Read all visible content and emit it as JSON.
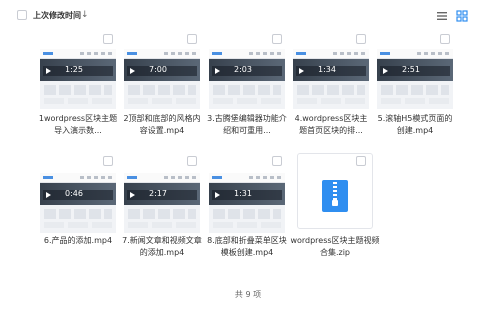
{
  "toolbar": {
    "sort_label": "上次修改时间",
    "sort_arrow": "↓",
    "list_view_icon": "list-view-icon",
    "grid_view_icon": "grid-view-icon",
    "active_view": "grid",
    "accent_color": "#2f8ef0"
  },
  "files": [
    {
      "name": "1wordpress区块主题导入演示数...",
      "type": "video",
      "duration": "1:25"
    },
    {
      "name": "2顶部和底部的风格内容设置.mp4",
      "type": "video",
      "duration": "7:00"
    },
    {
      "name": "3.古腾堡编辑器功能介绍和可重用...",
      "type": "video",
      "duration": "2:03"
    },
    {
      "name": "4.wordpress区块主题首页区块的排...",
      "type": "video",
      "duration": "1:34"
    },
    {
      "name": "5.滚轴H5模式页面的创建.mp4",
      "type": "video",
      "duration": "2:51"
    },
    {
      "name": "6.产品的添加.mp4",
      "type": "video",
      "duration": "0:46"
    },
    {
      "name": "7.新闻文章和视频文章的添加.mp4",
      "type": "video",
      "duration": "2:17"
    },
    {
      "name": "8.底部和折叠菜单区块模板创建.mp4",
      "type": "video",
      "duration": "1:31"
    },
    {
      "name": "wordpress区块主题视频合集.zip",
      "type": "zip",
      "duration": ""
    }
  ],
  "footer": {
    "count_text": "共 9 项"
  }
}
